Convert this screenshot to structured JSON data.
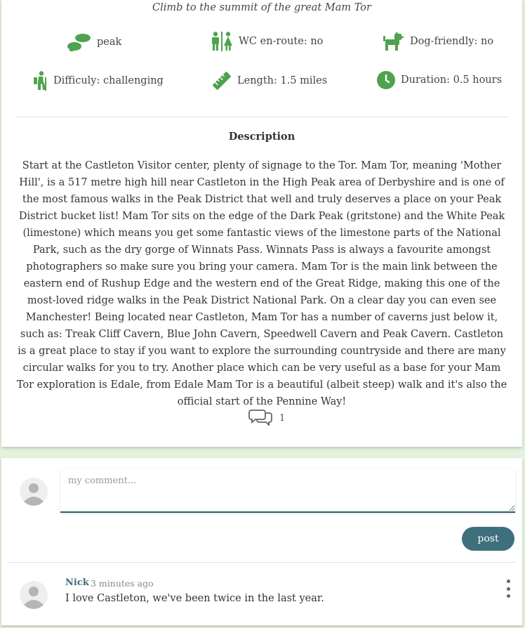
{
  "route": {
    "subtitle": "Climb to the summit of the great Mam Tor"
  },
  "features": {
    "type": {
      "label": "peak",
      "icon": "footprints-icon"
    },
    "wc": {
      "label": "WC en-route: no",
      "icon": "restroom-icon"
    },
    "dog": {
      "label": "Dog-friendly: no",
      "icon": "dog-icon"
    },
    "difficulty": {
      "label": "Difficuly: challenging",
      "icon": "hiker-icon"
    },
    "length": {
      "label": "Length: 1.5 miles",
      "icon": "ruler-icon"
    },
    "duration": {
      "label": "Duration: 0.5 hours",
      "icon": "clock-icon"
    }
  },
  "description": {
    "title": "Description",
    "body": "Start at the Castleton Visitor center, plenty of signage to the Tor. Mam Tor, meaning 'Mother Hill', is a 517 metre high hill near Castleton in the High Peak area of Derbyshire and is one of the most famous walks in the Peak District that well and truly deserves a place on your Peak District bucket list! Mam Tor sits on the edge of the Dark Peak (gritstone) and the White Peak (limestone) which means you get some fantastic views of the limestone parts of the National Park, such as the dry gorge of Winnats Pass. Winnats Pass is always a favourite amongst photographers so make sure you bring your camera. Mam Tor is the main link between the eastern end of Rushup Edge and the western end of the Great Ridge, making this one of the most-loved ridge walks in the Peak District National Park. On a clear day you can even see Manchester! Being located near Castleton, Mam Tor has a number of caverns just below it, such as: Treak Cliff Cavern, Blue John Cavern, Speedwell Cavern and Peak Cavern. Castleton is a great place to stay if you want to explore the surrounding countryside and there are many circular walks for you to try. Another place which can be very useful as a base for your Mam Tor exploration is Edale, from Edale Mam Tor is a beautiful (albeit steep) walk and it's also the official start of the Pennine Way!"
  },
  "comments_count": "1",
  "comment_form": {
    "placeholder": "my comment...",
    "post_label": "post"
  },
  "comments": [
    {
      "author": "Nick",
      "time": "3 minutes ago",
      "text": "I love Castleton, we've been twice in the last year."
    }
  ],
  "colors": {
    "icon_green": "#4fa24f",
    "accent_teal": "#3d6f7c",
    "page_background": "#e4f1dc"
  }
}
